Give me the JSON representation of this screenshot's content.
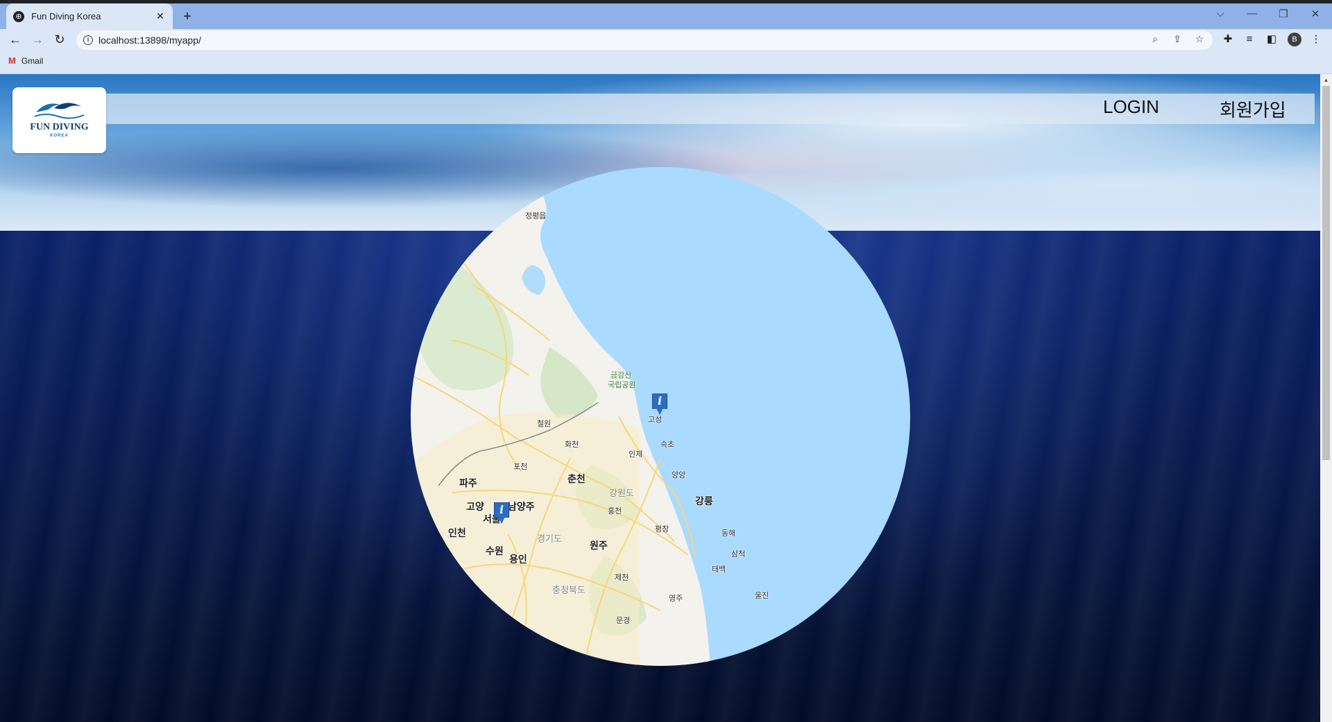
{
  "browser": {
    "tab_title": "Fun Diving Korea",
    "tab_close": "✕",
    "new_tab": "+",
    "url": "localhost:13898/myapp/",
    "bookmark": "Gmail",
    "profile_initial": "B",
    "window_controls": {
      "tabsearch": "⌵",
      "minimize": "—",
      "restore": "❐",
      "close": "✕"
    },
    "icons": [
      "back-arrow-icon",
      "forward-arrow-icon",
      "reload-icon",
      "info-icon",
      "zoom-icon",
      "share-icon",
      "bookmark-star-icon",
      "extensions-icon",
      "reading-list-icon",
      "side-panel-icon",
      "menu-kebab-icon"
    ]
  },
  "site": {
    "logo_title": "FUN DIVING",
    "logo_sub": "KOREA",
    "nav": {
      "login": "LOGIN",
      "signup": "회원가입"
    }
  },
  "map": {
    "water_color": "#aadaff",
    "land_color": "#f5f4ee",
    "road_color": "#f8d67a",
    "labels": {
      "jeongpyeong": "정평읍",
      "geumgang": "금강산",
      "geumgang2": "국립공원",
      "goseong": "고성",
      "sokcho": "속초",
      "inje": "인제",
      "yangyang": "양양",
      "cheorwon": "철원",
      "hwacheon": "화천",
      "pocheon": "포천",
      "chuncheon": "춘천",
      "gangwondo": "강원도",
      "gangneung": "강릉",
      "paju": "파주",
      "goyang": "고양",
      "namyangju": "남양주",
      "seoul": "서울",
      "hongcheon": "홍천",
      "pyeongchang": "평창",
      "donghae": "동해",
      "incheon": "인천",
      "gyeonggido": "경기도",
      "suwon": "수원",
      "yongin": "용인",
      "wonju": "원주",
      "samcheok": "삼척",
      "taebaek": "태백",
      "jecheon": "제천",
      "chungbuk": "충청북도",
      "yeongju": "영주",
      "uljin": "울진",
      "mungyeong": "문경"
    },
    "markers": [
      {
        "symbol": "i"
      },
      {
        "symbol": "i"
      }
    ]
  }
}
